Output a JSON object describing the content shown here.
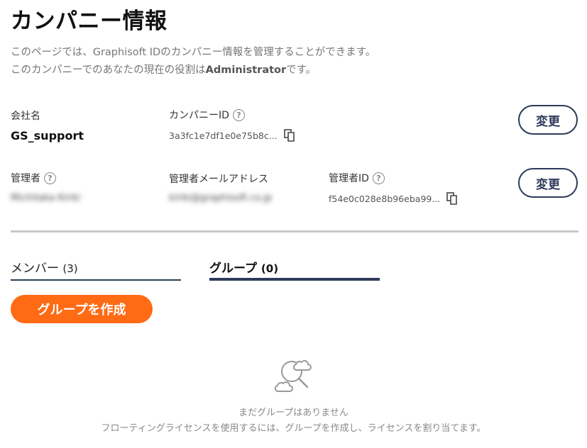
{
  "page": {
    "title": "カンパニー情報",
    "description_line1": "このページでは、Graphisoft IDのカンパニー情報を管理することができます。",
    "description_line2_prefix": "このカンパニーでのあなたの現在の役割は",
    "description_line2_role": "Administrator",
    "description_line2_suffix": "です。"
  },
  "company": {
    "name_label": "会社名",
    "name_value": "GS_support",
    "id_label": "カンパニーID",
    "id_value": "3a3fc1e7df1e0e75b8c...",
    "change_label": "変更"
  },
  "admin": {
    "admin_label": "管理者",
    "admin_value": "Michitaka Kiriki",
    "email_label": "管理者メールアドレス",
    "email_value": "kiriki@graphisoft.co.jp",
    "id_label": "管理者ID",
    "id_value": "f54e0c028e8b96eba99...",
    "change_label": "変更"
  },
  "tabs": {
    "members_label": "メンバー",
    "members_count": "(3)",
    "groups_label": "グループ",
    "groups_count": "(0)"
  },
  "actions": {
    "create_group_label": "グループを作成"
  },
  "empty_state": {
    "title": "まだグループはありません",
    "description": "フローティングライセンスを使用するには、グループを作成し、ライセンスを割り当てます。"
  },
  "colors": {
    "accent_orange": "#ff6a14",
    "navy": "#2d3a5c"
  }
}
